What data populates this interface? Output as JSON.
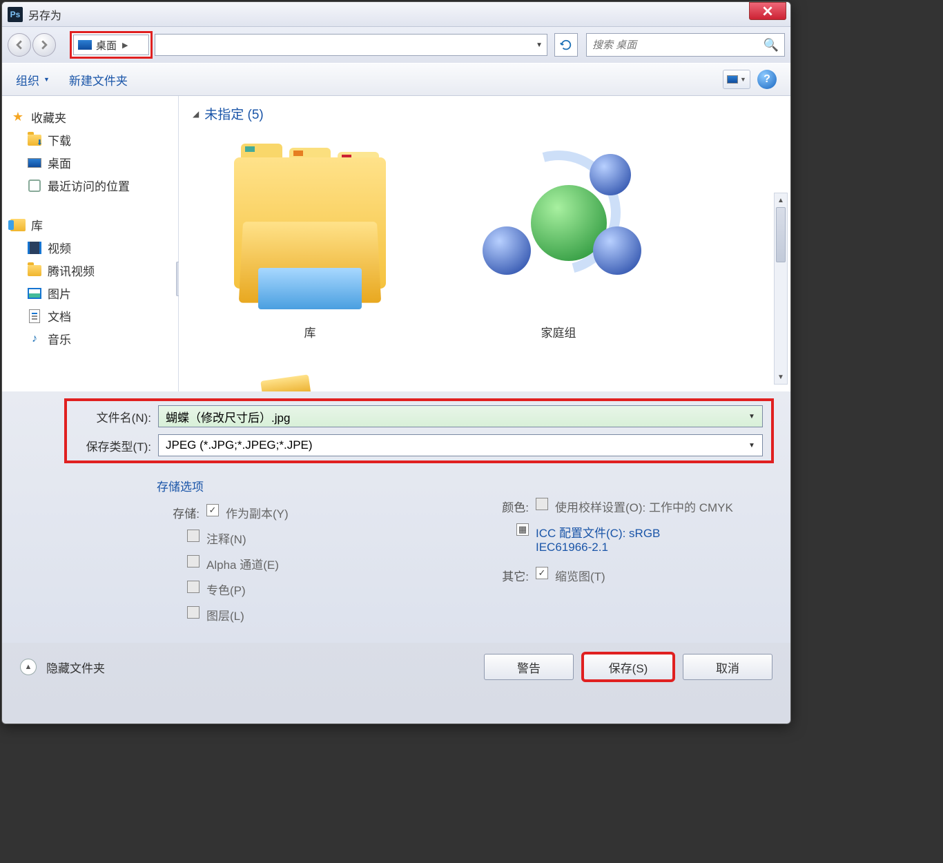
{
  "title": "另存为",
  "breadcrumb": {
    "location": "桌面"
  },
  "search": {
    "placeholder": "搜索 桌面"
  },
  "toolbar": {
    "organize": "组织",
    "new_folder": "新建文件夹"
  },
  "sidebar": {
    "favorites": "收藏夹",
    "fav_items": [
      "下载",
      "桌面",
      "最近访问的位置"
    ],
    "libraries": "库",
    "lib_items": [
      "视频",
      "腾讯视频",
      "图片",
      "文档",
      "音乐"
    ]
  },
  "content": {
    "group_header": "未指定 (5)",
    "thumbs": [
      "库",
      "家庭组"
    ]
  },
  "form": {
    "filename_label": "文件名(N):",
    "filename_value": "蝴蝶（修改尺寸后）.jpg",
    "filetype_label": "保存类型(T):",
    "filetype_value": "JPEG (*.JPG;*.JPEG;*.JPE)"
  },
  "options": {
    "header": "存储选项",
    "store_label": "存储:",
    "as_copy": "作为副本(Y)",
    "annotations": "注释(N)",
    "alpha": "Alpha 通道(E)",
    "spot": "专色(P)",
    "layers": "图层(L)",
    "color_label": "颜色:",
    "proof": "使用校样设置(O): 工作中的 CMYK",
    "icc": "ICC 配置文件(C): sRGB IEC61966-2.1",
    "other_label": "其它:",
    "thumbnail": "缩览图(T)"
  },
  "footer": {
    "hide": "隐藏文件夹",
    "warn": "警告",
    "save": "保存(S)",
    "cancel": "取消"
  }
}
